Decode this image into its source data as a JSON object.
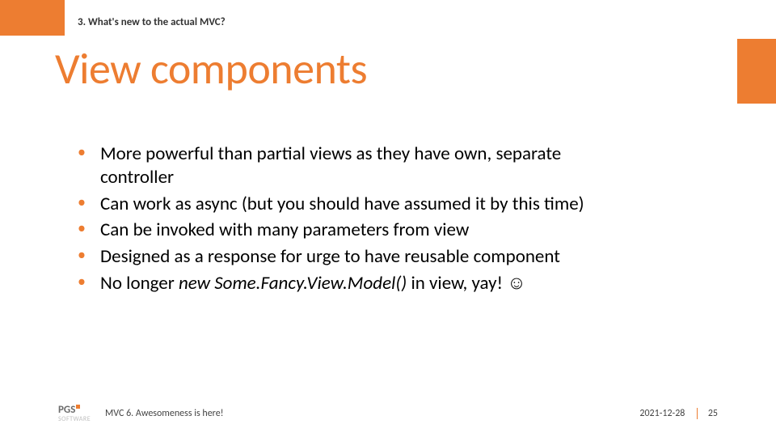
{
  "header": {
    "section_label": "3. What's new to the actual MVC?",
    "title": "View components"
  },
  "bullets": [
    {
      "text": "More powerful than partial views as they have own, separate controller"
    },
    {
      "text": "Can work as async (but you should have assumed it by this time)"
    },
    {
      "text": "Can be invoked with many parameters from view"
    },
    {
      "text": "Designed as a response for urge to have reusable component"
    },
    {
      "prefix": "No longer ",
      "italic": "new Some.Fancy.View.Model() ",
      "suffix": "in view, yay! ☺"
    }
  ],
  "footer": {
    "logo_main": "PGS",
    "logo_sub": "SOFTWARE",
    "text": "MVC 6. Awesomeness is here!",
    "date": "2021-12-28",
    "page": "25"
  },
  "colors": {
    "accent": "#ed7d31"
  }
}
